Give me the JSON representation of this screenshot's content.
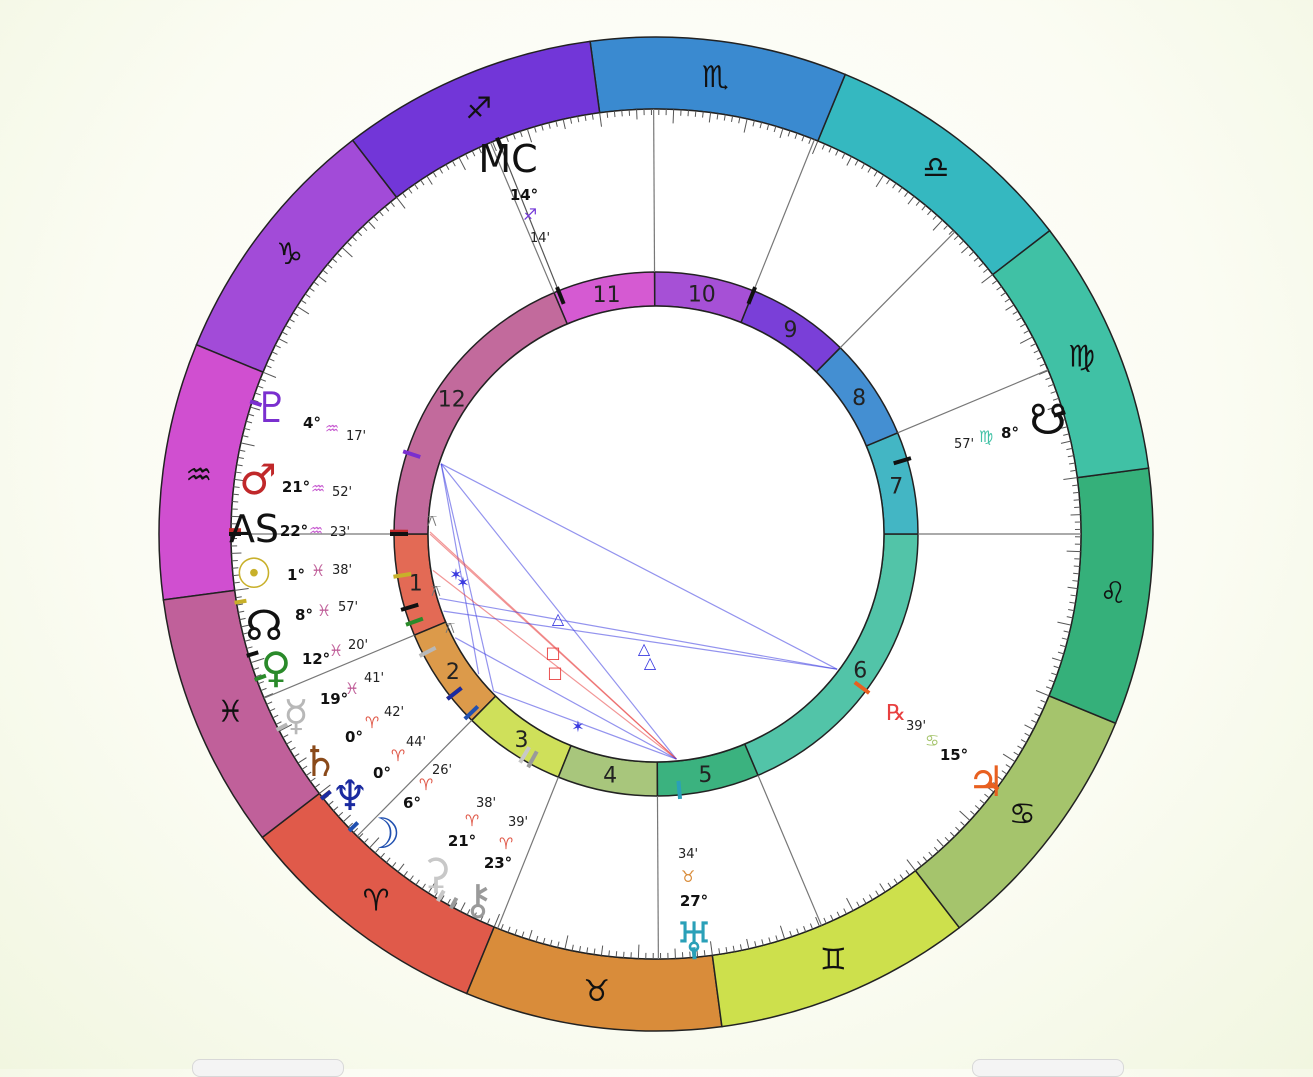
{
  "chart": {
    "ascendant_label": "AS",
    "midheaven_label": "MC",
    "retrograde_label": "℞",
    "zodiac": [
      {
        "name": "aries",
        "glyph": "♈",
        "color": "#e05a4a"
      },
      {
        "name": "taurus",
        "glyph": "♉",
        "color": "#d98c3a"
      },
      {
        "name": "gemini",
        "glyph": "♊",
        "color": "#cde04c"
      },
      {
        "name": "cancer",
        "glyph": "♋",
        "color": "#a5c46c"
      },
      {
        "name": "leo",
        "glyph": "♌",
        "color": "#35b07a"
      },
      {
        "name": "virgo",
        "glyph": "♍",
        "color": "#40c1a5"
      },
      {
        "name": "libra",
        "glyph": "♎",
        "color": "#35b8c0"
      },
      {
        "name": "scorpio",
        "glyph": "♏",
        "color": "#3a8ad0"
      },
      {
        "name": "sagittarius",
        "glyph": "♐",
        "color": "#7236d8"
      },
      {
        "name": "capricorn",
        "glyph": "♑",
        "color": "#a24bd8"
      },
      {
        "name": "aquarius",
        "glyph": "♒",
        "color": "#d04fd0"
      },
      {
        "name": "pisces",
        "glyph": "♓",
        "color": "#c0609a"
      }
    ],
    "houses": [
      {
        "number": "1",
        "color": "#e36a55"
      },
      {
        "number": "2",
        "color": "#dc9a4a"
      },
      {
        "number": "3",
        "color": "#cfe05a"
      },
      {
        "number": "4",
        "color": "#a8c67c"
      },
      {
        "number": "5",
        "color": "#3bb27f"
      },
      {
        "number": "6",
        "color": "#52c4a8"
      },
      {
        "number": "7",
        "color": "#43b6c4"
      },
      {
        "number": "8",
        "color": "#448fd2"
      },
      {
        "number": "9",
        "color": "#7a3fd8"
      },
      {
        "number": "10",
        "color": "#a650d6"
      },
      {
        "number": "11",
        "color": "#d55ad2"
      },
      {
        "number": "12",
        "color": "#c26a9c"
      }
    ],
    "points": [
      {
        "id": "pluto",
        "glyph": "♇",
        "deg": "4°",
        "sign": "♒",
        "min": "17'",
        "color": "#7a2fcf",
        "sign_color": "#c75ad0"
      },
      {
        "id": "mars",
        "glyph": "♂",
        "deg": "21°",
        "sign": "♒",
        "min": "52'",
        "color": "#c0282a",
        "sign_color": "#c75ad0"
      },
      {
        "id": "ascendant",
        "glyph": "AS",
        "deg": "22°",
        "sign": "♒",
        "min": "23'",
        "color": "#111111",
        "sign_color": "#c75ad0"
      },
      {
        "id": "sun",
        "glyph": "☉",
        "deg": "1°",
        "sign": "♓",
        "min": "38'",
        "color": "#c8b02a",
        "sign_color": "#c0609a"
      },
      {
        "id": "north-node",
        "glyph": "☊",
        "deg": "8°",
        "sign": "♓",
        "min": "57'",
        "color": "#111111",
        "sign_color": "#c0609a"
      },
      {
        "id": "venus",
        "glyph": "♀",
        "deg": "12°",
        "sign": "♓",
        "min": "20'",
        "color": "#2a8a2a",
        "sign_color": "#c0609a"
      },
      {
        "id": "mercury",
        "glyph": "☿",
        "deg": "19°",
        "sign": "♓",
        "min": "41'",
        "color": "#b8b8b8",
        "sign_color": "#c0609a"
      },
      {
        "id": "saturn",
        "glyph": "♄",
        "deg": "0°",
        "sign": "♈",
        "min": "42'",
        "color": "#8a4a1a",
        "sign_color": "#e05a4a"
      },
      {
        "id": "neptune",
        "glyph": "♆",
        "deg": "0°",
        "sign": "♈",
        "min": "44'",
        "color": "#1a2aa0",
        "sign_color": "#e05a4a"
      },
      {
        "id": "moon",
        "glyph": "☽",
        "deg": "6°",
        "sign": "♈",
        "min": "26'",
        "color": "#2050b0",
        "sign_color": "#e05a4a"
      },
      {
        "id": "chiron",
        "glyph": "⚷",
        "deg": "23°",
        "sign": "♈",
        "min": "39'",
        "color": "#9a9a9a",
        "sign_color": "#e05a4a"
      },
      {
        "id": "ceres",
        "glyph": "⚳",
        "deg": "21°",
        "sign": "♈",
        "min": "38'",
        "color": "#c8c8c8",
        "sign_color": "#e05a4a"
      },
      {
        "id": "uranus",
        "glyph": "♅",
        "deg": "27°",
        "sign": "♉",
        "min": "34'",
        "color": "#2aa0b8",
        "sign_color": "#d98c3a"
      },
      {
        "id": "jupiter",
        "glyph": "♃",
        "deg": "15°",
        "sign": "♋",
        "min": "39'",
        "color": "#e86020",
        "sign_color": "#a5c46c"
      },
      {
        "id": "south-node",
        "glyph": "☋",
        "deg": "8°",
        "sign": "♍",
        "min": "57'",
        "color": "#111111",
        "sign_color": "#40c1a5"
      },
      {
        "id": "midheaven",
        "glyph": "MC",
        "deg": "14°",
        "sign": "♐",
        "min": "14'",
        "color": "#111111",
        "sign_color": "#7236d8"
      }
    ],
    "aspect_glyphs": {
      "trine": "△",
      "square": "□",
      "sextile": "✶",
      "quincunx": "⚻"
    },
    "colors": {
      "aspect_blue": "#3a3ae0",
      "aspect_red": "#e84040",
      "line": "#777777"
    }
  }
}
